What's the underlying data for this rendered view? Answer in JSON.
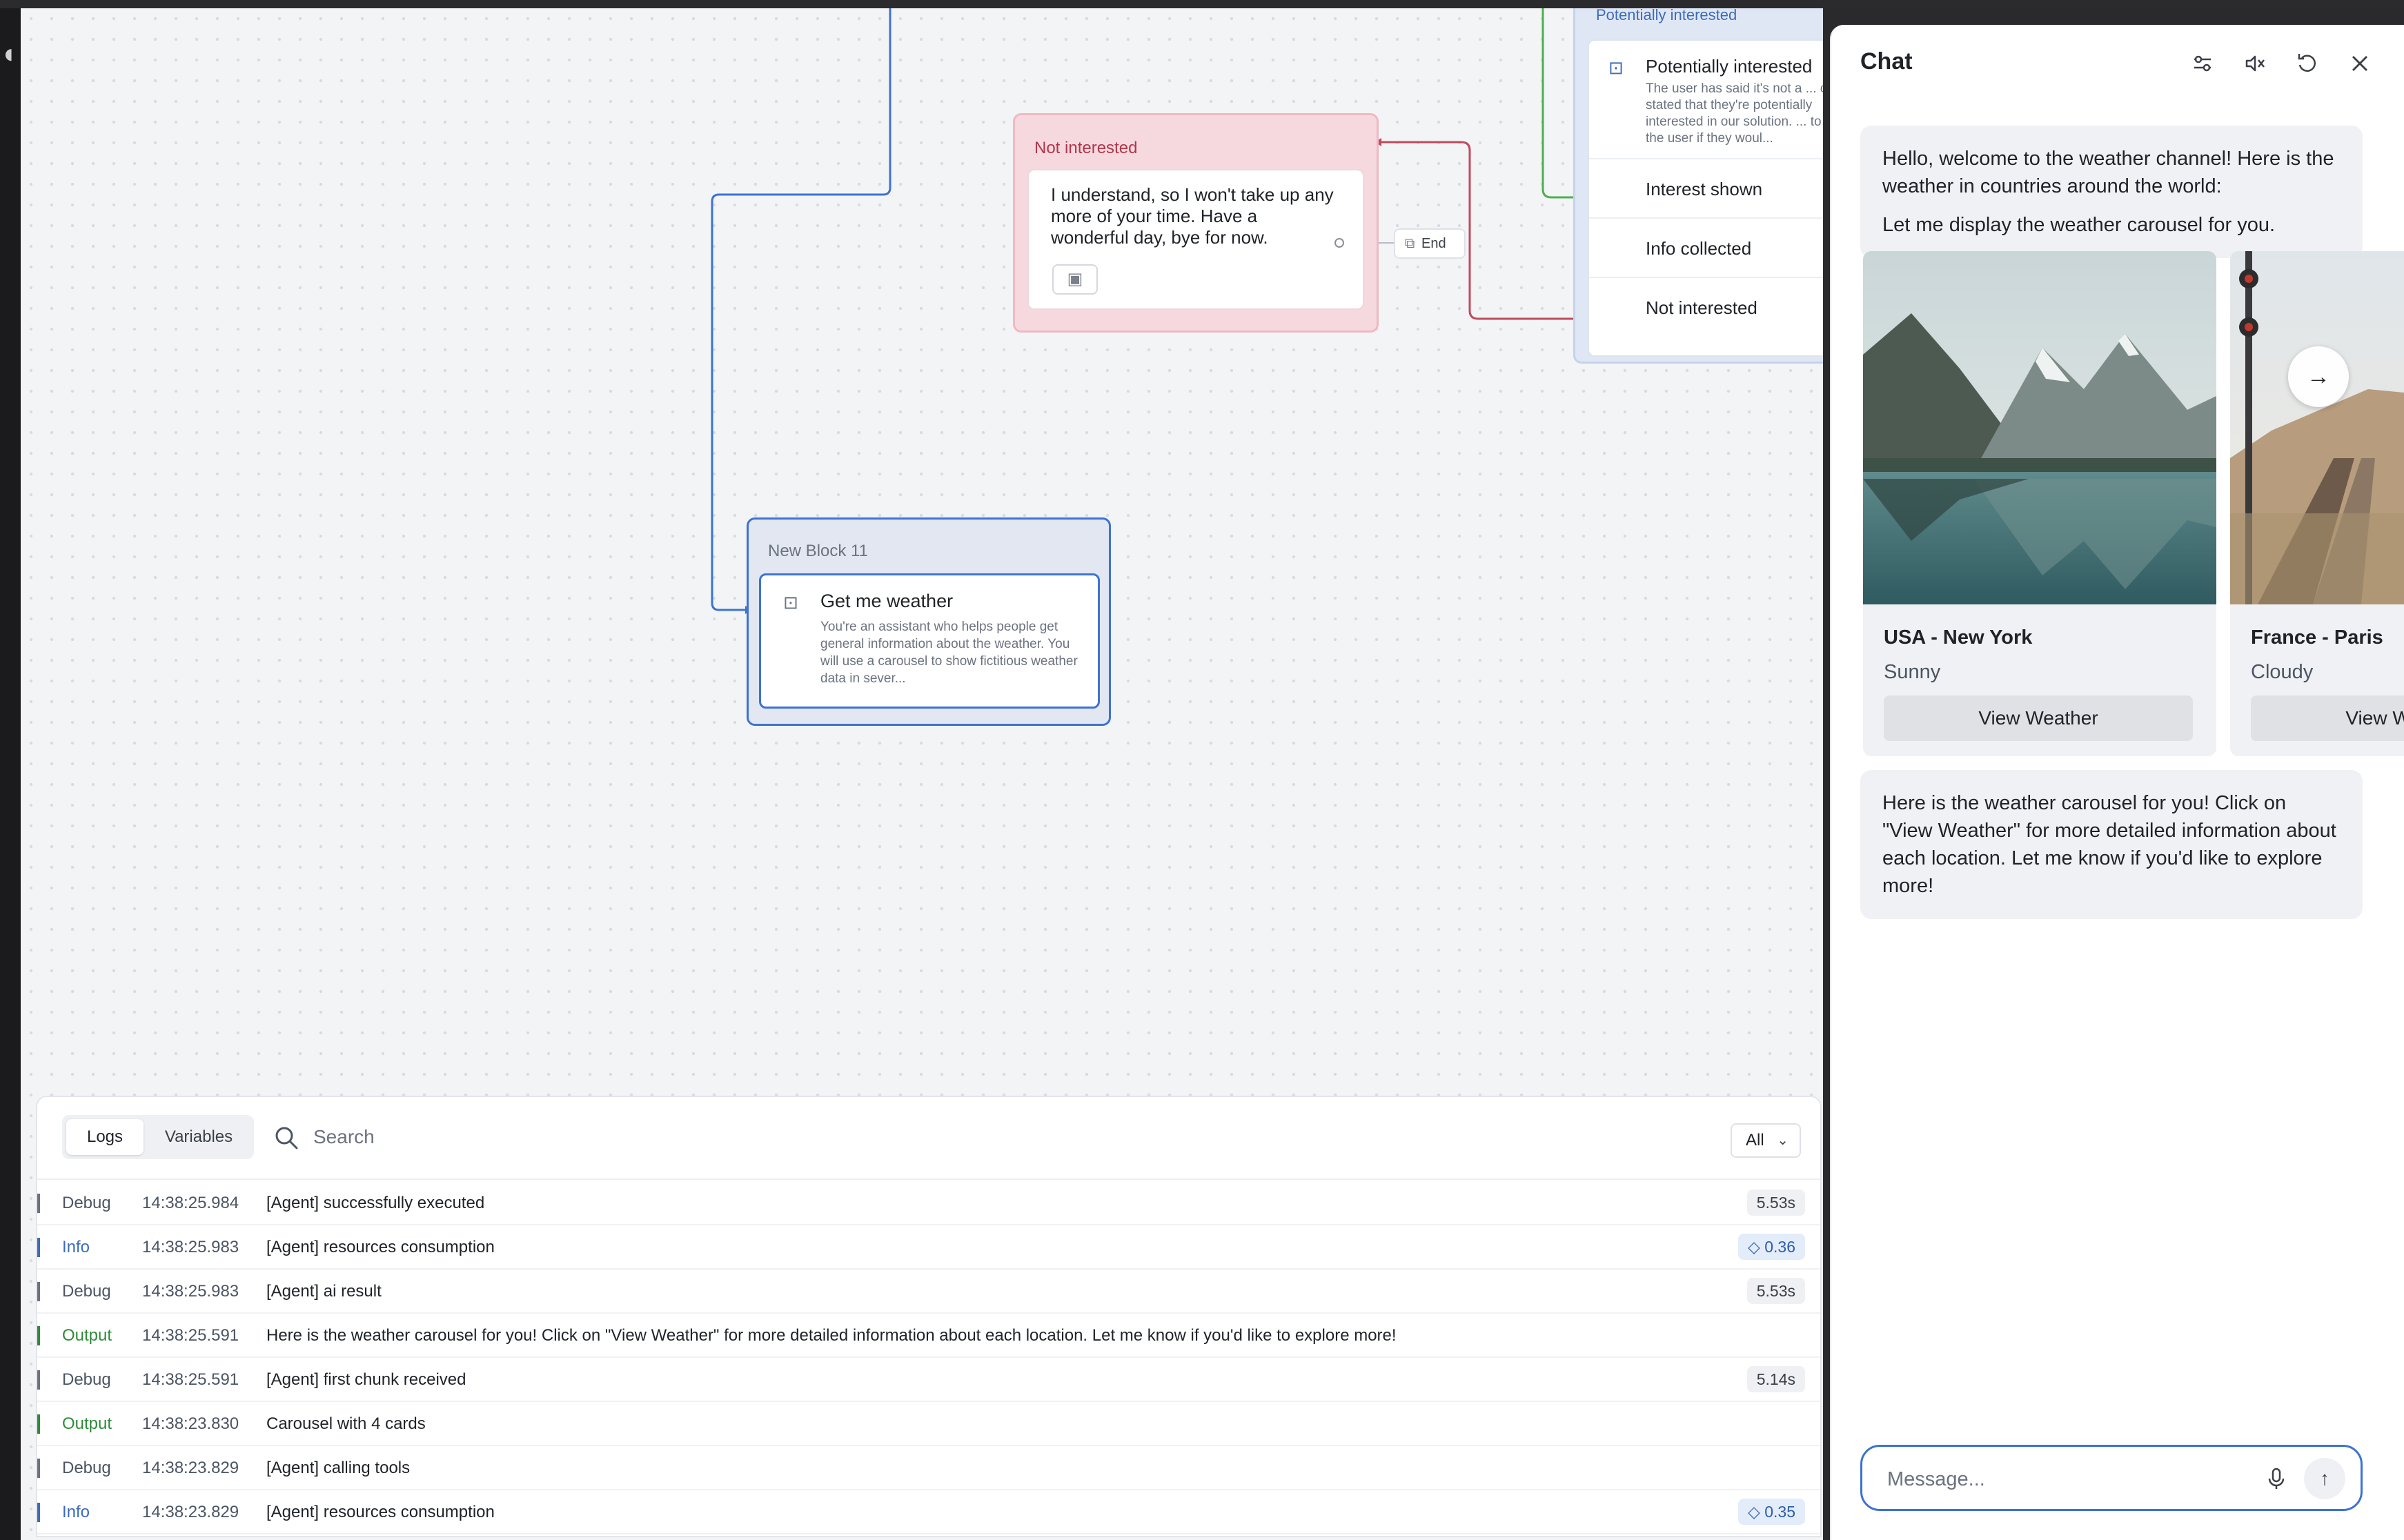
{
  "canvas": {
    "not_interested_block": {
      "title": "Not interested",
      "message": "I understand, so I won't take up any more of your time. Have a wonderful day, bye for now.",
      "end_label": "End"
    },
    "potentially_interested_block": {
      "header": "Potentially interested",
      "title": "Potentially interested",
      "description": "The user has said it's not a ... or stated that they're potentially interested in our solution. ... to ask the user if they woul...",
      "options": [
        "Interest shown",
        "Info collected",
        "Not interested"
      ]
    },
    "new_block": {
      "title": "New Block 11",
      "agent_title": "Get me weather",
      "agent_description": "You're an assistant who helps people get general information about the weather. You will use a carousel to show fictitious weather data in sever..."
    }
  },
  "logs": {
    "tabs": [
      "Logs",
      "Variables"
    ],
    "search_placeholder": "Search",
    "filter_value": "All",
    "rows": [
      {
        "level": "Debug",
        "time": "14:38:25.984",
        "text": "[Agent] successfully executed",
        "badge": "5.53s",
        "badge_type": "duration"
      },
      {
        "level": "Info",
        "time": "14:38:25.983",
        "text": "[Agent] resources consumption",
        "badge": "0.36",
        "badge_type": "cost"
      },
      {
        "level": "Debug",
        "time": "14:38:25.983",
        "text": "[Agent] ai result",
        "badge": "5.53s",
        "badge_type": "duration"
      },
      {
        "level": "Output",
        "time": "14:38:25.591",
        "text": "Here is the weather carousel for you! Click on \"View Weather\" for more detailed information about each location. Let me know if you'd like to explore more!",
        "badge": "",
        "badge_type": ""
      },
      {
        "level": "Debug",
        "time": "14:38:25.591",
        "text": "[Agent] first chunk received",
        "badge": "5.14s",
        "badge_type": "duration"
      },
      {
        "level": "Output",
        "time": "14:38:23.830",
        "text": "Carousel with 4 cards",
        "badge": "",
        "badge_type": ""
      },
      {
        "level": "Debug",
        "time": "14:38:23.829",
        "text": "[Agent] calling tools",
        "badge": "",
        "badge_type": ""
      },
      {
        "level": "Info",
        "time": "14:38:23.829",
        "text": "[Agent] resources consumption",
        "badge": "0.35",
        "badge_type": "cost"
      }
    ]
  },
  "chat": {
    "title": "Chat",
    "intro_line1": "Hello, welcome to the weather channel! Here is the weather in countries around the world:",
    "intro_line2": "Let me display the weather carousel for you.",
    "cards": [
      {
        "name": "USA - New York",
        "condition": "Sunny",
        "button": "View Weather"
      },
      {
        "name": "France - Paris",
        "condition": "Cloudy",
        "button": "View Weather"
      }
    ],
    "closing": "Here is the weather carousel for you! Click on \"View Weather\" for more detailed information about each location. Let me know if you'd like to explore more!",
    "input_placeholder": "Message..."
  },
  "icons": {
    "chat_settings": "sliders-icon",
    "chat_mute": "speaker-mute-icon",
    "chat_reset": "reset-icon",
    "chat_close": "close-icon",
    "mic": "microphone-icon",
    "send": "arrow-up-icon",
    "carousel_next": "arrow-right-icon",
    "search": "search-icon",
    "agent": "robot-icon"
  },
  "colors": {
    "accent_blue": "#3d73d2",
    "not_interested_bg": "#f6d9df",
    "not_interested_text": "#b0374b",
    "output_green": "#2f8a3a",
    "info_blue": "#3e6cb6"
  }
}
